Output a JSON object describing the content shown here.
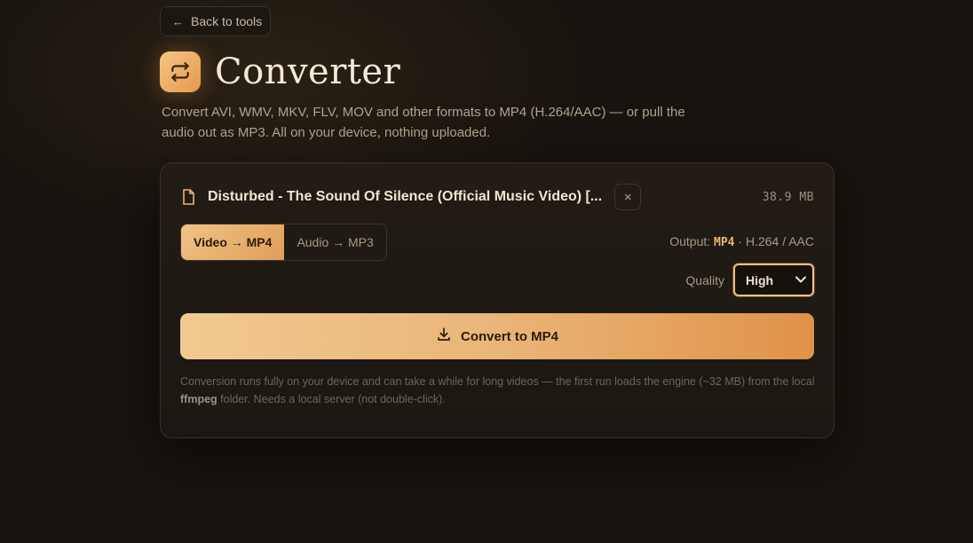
{
  "nav": {
    "back_label": "Back to tools"
  },
  "header": {
    "title": "Converter",
    "subtitle": "Convert AVI, WMV, MKV, FLV, MOV and other formats to MP4 (H.264/AAC) — or pull the audio out as MP3. All on your device, nothing uploaded."
  },
  "file": {
    "name": "Disturbed - The Sound Of Silence (Official Music Video) [...",
    "size": "38.9 MB",
    "remove_symbol": "×"
  },
  "modes": [
    {
      "label": "Video → MP4",
      "active": true
    },
    {
      "label": "Audio → MP3",
      "active": false
    }
  ],
  "output": {
    "prefix": "Output:",
    "format": "MP4",
    "codecs": "· H.264 / AAC"
  },
  "quality": {
    "label": "Quality",
    "selected": "High"
  },
  "convert": {
    "label": "Convert to MP4"
  },
  "note": {
    "text_before": "Conversion runs fully on your device and can take a while for long videos — the first run loads the engine (~32 MB) from the local",
    "code": "ffmpeg",
    "text_after": "folder. Needs a local server (not double-click)."
  },
  "icons": {
    "back": "arrow-left-icon",
    "logo": "swap-arrows-icon",
    "file": "file-icon",
    "remove": "close-icon",
    "dropdown": "chevron-down-icon",
    "download": "download-icon"
  },
  "colors": {
    "accent": "#e8a560",
    "accent_light": "#f1ca8f",
    "background": "#17130e",
    "card": "#201a14"
  }
}
